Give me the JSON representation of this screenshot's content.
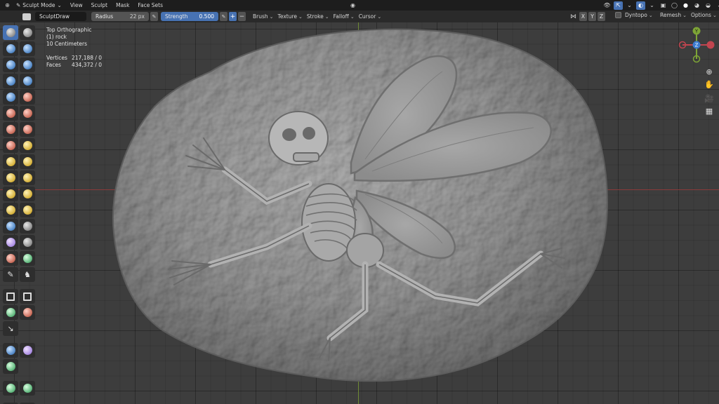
{
  "menubar": {
    "mode": "Sculpt Mode",
    "items": [
      "View",
      "Sculpt",
      "Mask",
      "Face Sets"
    ]
  },
  "tool_header": {
    "brush_name": "SculptDraw",
    "radius_label": "Radius",
    "radius_value": "22 px",
    "strength_label": "Strength",
    "strength_value": "0.500",
    "dropdowns": [
      "Brush",
      "Texture",
      "Stroke",
      "Falloff",
      "Cursor"
    ],
    "symmetry_axes": [
      "X",
      "Y",
      "Z"
    ],
    "dyntopo_label": "Dyntopo",
    "remesh_label": "Remesh",
    "options_label": "Options"
  },
  "viewport_overlay": {
    "view_name": "Top Orthographic",
    "object_name": "(1) rock",
    "scale": "10 Centimeters",
    "vertices_label": "Vertices",
    "vertices_value": "217,188 / 0",
    "faces_label": "Faces",
    "faces_value": "434,372 / 0"
  },
  "gizmo": {
    "y_label": "Y",
    "z_label": "Z"
  },
  "colors": {
    "accent": "#4772b3",
    "x_axis": "#c1454f",
    "y_axis": "#7ea536",
    "z_axis": "#3b7cd0"
  },
  "toolbar_icons": [
    "draw-brush",
    "draw-sharp-brush",
    "clay-brush",
    "clay-strips-brush",
    "clay-thumb-brush",
    "layer-brush",
    "inflate-brush",
    "blob-brush",
    "crease-brush",
    "smooth-brush",
    "flatten-brush",
    "fill-brush",
    "scrape-brush",
    "multiplane-scrape-brush",
    "pinch-brush",
    "grab-brush",
    "elastic-deform-brush",
    "snake-hook-brush",
    "thumb-brush",
    "pose-brush",
    "nudge-brush",
    "rotate-brush",
    "slide-relax-brush",
    "boundary-brush",
    "cloth-brush",
    "simplify-brush",
    "mask-brush",
    "draw-face-sets-brush",
    "multires-displacement-eraser",
    "multires-displacement-smear",
    "paint-brush",
    "smear-brush",
    "box-mask",
    "box-hide",
    "box-face-set",
    "box-trim",
    "line-project",
    "mesh-filter",
    "cloth-filter",
    "color-filter",
    "edit-face-set",
    "mask-by-color",
    "move-tool",
    "rotate-tool",
    "scale-tool"
  ]
}
